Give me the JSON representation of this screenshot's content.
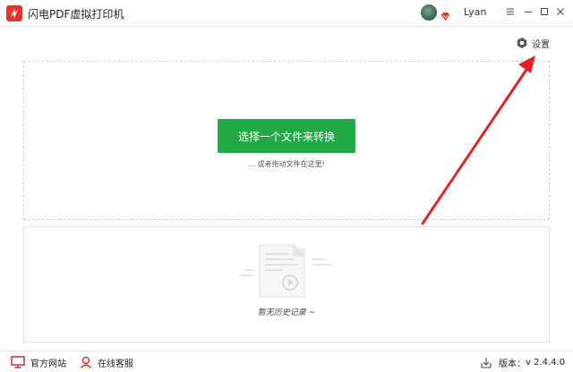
{
  "app": {
    "title": "闪电PDF虚拟打印机",
    "brand_color": "#e5352b"
  },
  "user": {
    "name": "Lyan"
  },
  "settings": {
    "label": "设置"
  },
  "drop_zone": {
    "button_label": "选择一个文件来转换",
    "hint": "... 或者拖动文件在这里!",
    "button_color": "#23a846"
  },
  "history": {
    "empty_text": "暂无历史记录 ~"
  },
  "statusbar": {
    "website_label": "官方网站",
    "service_label": "在线客服",
    "version_label": "版本：",
    "version_value": "v 2.4.4.0"
  },
  "annotation": {
    "arrow_color": "#e02020"
  }
}
